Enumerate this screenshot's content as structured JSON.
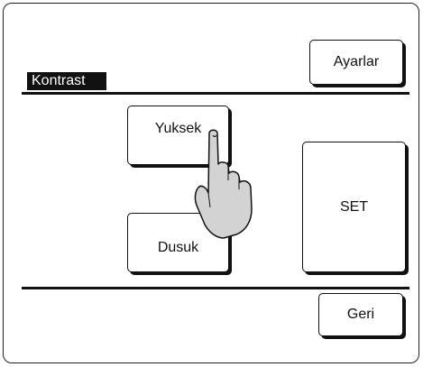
{
  "header": {
    "title": "Kontrast",
    "settings_label": "Ayarlar"
  },
  "contrast": {
    "high_label": "Yuksek",
    "low_label": "Dusuk"
  },
  "actions": {
    "set_label": "SET",
    "back_label": "Geri"
  },
  "icons": {
    "pointer": "hand-pointer-icon"
  }
}
